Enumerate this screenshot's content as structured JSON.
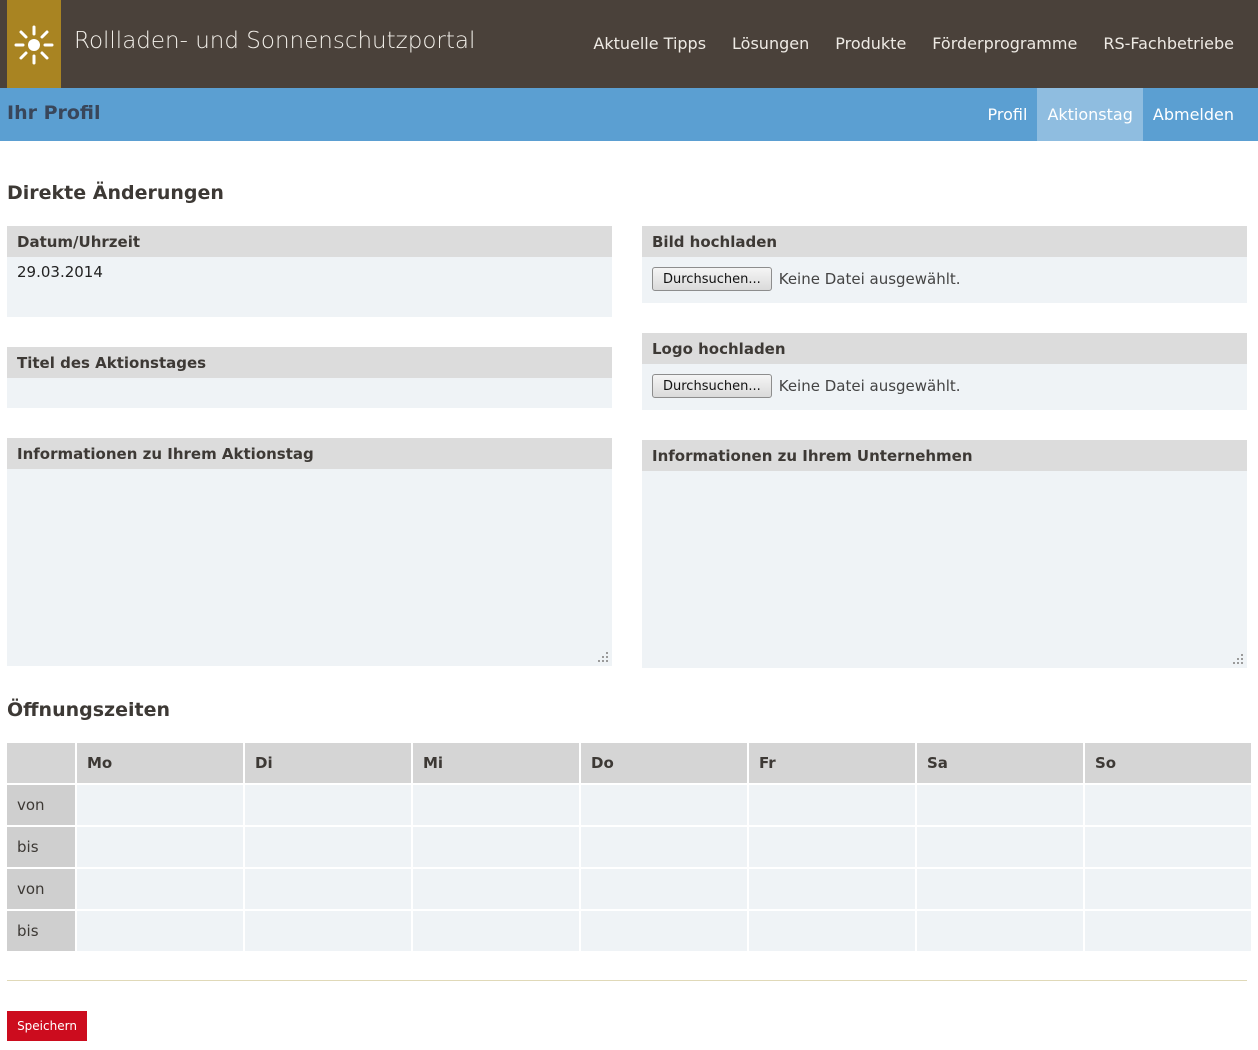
{
  "header": {
    "site_title": "Rollladen- und Sonnenschutzportal",
    "logo_icon": "sun-icon",
    "nav": [
      "Aktuelle Tipps",
      "Lösungen",
      "Produkte",
      "Förderprogramme",
      "RS-Fachbetriebe"
    ]
  },
  "subheader": {
    "title": "Ihr Profil",
    "nav": [
      {
        "label": "Profil",
        "active": false
      },
      {
        "label": "Aktionstag",
        "active": true
      },
      {
        "label": "Abmelden",
        "active": false
      }
    ]
  },
  "section_direct": {
    "heading": "Direkte Änderungen",
    "datetime": {
      "label": "Datum/Uhrzeit",
      "value": "29.03.2014"
    },
    "title_field": {
      "label": "Titel des Aktionstages",
      "value": ""
    },
    "info_day": {
      "label": "Informationen zu Ihrem Aktionstag",
      "value": ""
    },
    "image_upload": {
      "label": "Bild hochladen",
      "button": "Durchsuchen...",
      "status": "Keine Datei ausgewählt."
    },
    "logo_upload": {
      "label": "Logo hochladen",
      "button": "Durchsuchen...",
      "status": "Keine Datei ausgewählt."
    },
    "info_company": {
      "label": "Informationen zu Ihrem Unternehmen",
      "value": ""
    }
  },
  "hours": {
    "heading": "Öffnungszeiten",
    "days": [
      "Mo",
      "Di",
      "Mi",
      "Do",
      "Fr",
      "Sa",
      "So"
    ],
    "rows": [
      "von",
      "bis",
      "von",
      "bis"
    ]
  },
  "save_label": "Speichern",
  "colors": {
    "header_bg": "#4a413a",
    "logo_bg": "#a98422",
    "subbar_bg": "#5b9fd2",
    "subbar_active": "#8fbde0",
    "save_button": "#cc0c1e"
  }
}
